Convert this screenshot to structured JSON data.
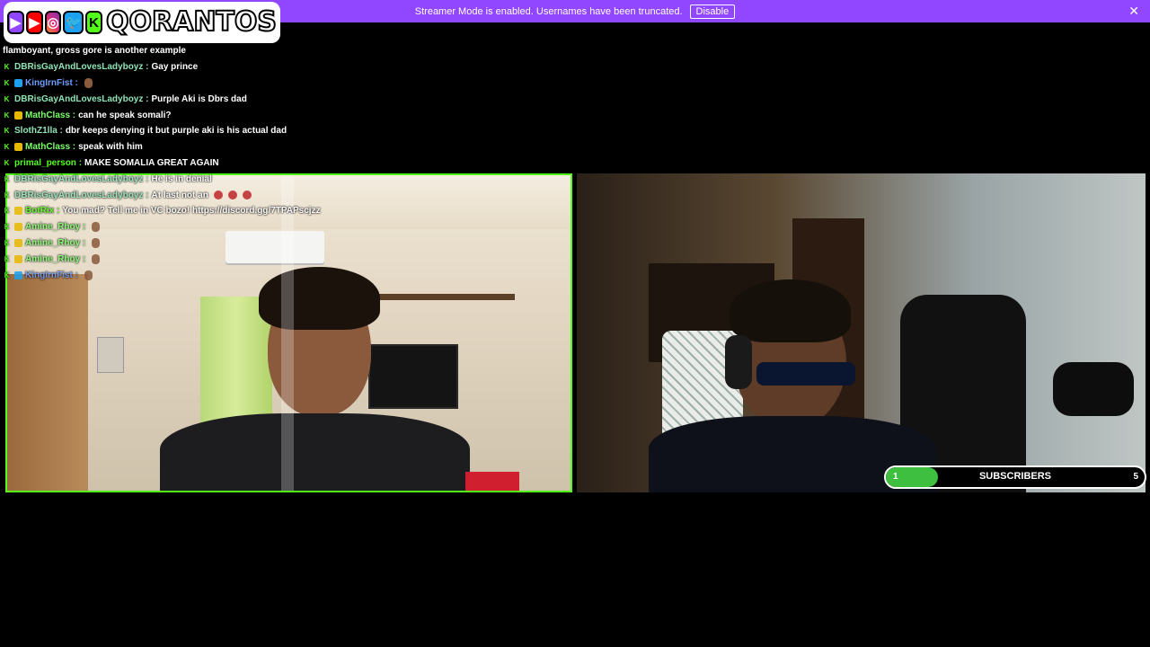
{
  "banner": {
    "message": "Streamer Mode is enabled. Usernames have been truncated.",
    "disable_label": "Disable",
    "close_glyph": "✕"
  },
  "social": {
    "icons": [
      "twitch-icon",
      "youtube-icon",
      "instagram-icon",
      "twitter-icon",
      "kick-icon"
    ],
    "icon_glyphs": [
      "▶",
      "▶",
      "◎",
      "🐦",
      "K"
    ],
    "name": "QORANTOS"
  },
  "chat": {
    "lines": [
      {
        "badge": "none",
        "user": "",
        "user_color": "#ffffff",
        "message": "flamboyant, gross gore is another example",
        "emote": ""
      },
      {
        "badge": "kick",
        "user": "DBRisGayAndLovesLadyboyz",
        "user_color": "#8fe3b6",
        "message": "Gay prince",
        "emote": ""
      },
      {
        "badge": "kick-blue",
        "user": "KingIrnFist",
        "user_color": "#6f9cff",
        "message": "",
        "emote": "person"
      },
      {
        "badge": "kick",
        "user": "DBRisGayAndLovesLadyboyz",
        "user_color": "#8fe3b6",
        "message": "Purple Aki is Dbrs dad",
        "emote": ""
      },
      {
        "badge": "kick-moon",
        "user": "MathClass",
        "user_color": "#7dff6b",
        "message": "can he speak somali?",
        "emote": ""
      },
      {
        "badge": "kick",
        "user": "SlothZ1lla",
        "user_color": "#8fe3b6",
        "message": "dbr keeps denying it but purple aki is his actual dad",
        "emote": ""
      },
      {
        "badge": "kick-moon",
        "user": "MathClass",
        "user_color": "#7dff6b",
        "message": "speak with him",
        "emote": ""
      },
      {
        "badge": "kick",
        "user": "primal_person",
        "user_color": "#53fc18",
        "message": "MAKE SOMALIA GREAT AGAIN",
        "emote": ""
      },
      {
        "badge": "kick",
        "user": "DBRisGayAndLovesLadyboyz",
        "user_color": "#8fe3b6",
        "message": "He is in denial",
        "emote": ""
      },
      {
        "badge": "kick",
        "user": "DBRisGayAndLovesLadyboyz",
        "user_color": "#8fe3b6",
        "message": "At last not an",
        "emote": "gloves"
      },
      {
        "badge": "kick-bot",
        "user": "BotRix",
        "user_color": "#53fc18",
        "message": "You mad? Tell me in VC bozo! https://discord.gg/7TPAPscjzz",
        "emote": ""
      },
      {
        "badge": "kick-moon",
        "user": "Amine_Rhoy",
        "user_color": "#7dff6b",
        "message": "",
        "emote": "person"
      },
      {
        "badge": "kick-moon",
        "user": "Amine_Rhoy",
        "user_color": "#7dff6b",
        "message": "",
        "emote": "person"
      },
      {
        "badge": "kick-moon",
        "user": "Amine_Rhoy",
        "user_color": "#7dff6b",
        "message": "",
        "emote": "person"
      },
      {
        "badge": "kick-blue",
        "user": "KingIrnFist",
        "user_color": "#6f9cff",
        "message": "",
        "emote": "person"
      }
    ]
  },
  "goal": {
    "label": "SUBSCRIBERS",
    "current": "1",
    "target": "5",
    "progress": 0.2,
    "fill_color": "#3fbf3f"
  },
  "colors": {
    "banner_bg": "#9146ff",
    "kick_green": "#53fc18",
    "background": "#000000"
  }
}
